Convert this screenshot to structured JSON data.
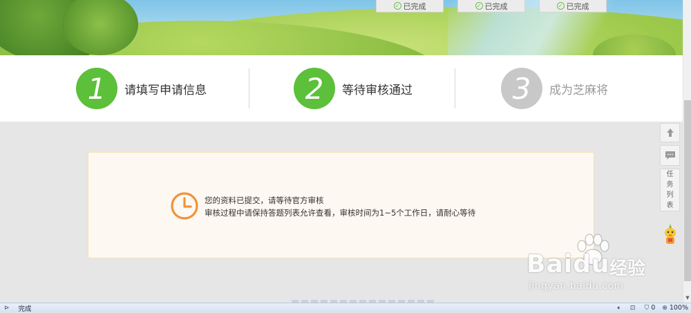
{
  "banner": {
    "done_tabs": [
      {
        "label": "已完成"
      },
      {
        "label": "已完成"
      },
      {
        "label": "已完成"
      }
    ]
  },
  "steps": [
    {
      "number": "1",
      "label": "请填写申请信息",
      "active": true
    },
    {
      "number": "2",
      "label": "等待审核通过",
      "active": true
    },
    {
      "number": "3",
      "label": "成为芝麻将",
      "active": false
    }
  ],
  "notice": {
    "line1": "您的资料已提交，请等待官方审核",
    "line2": "审核过程中请保持答题列表允许查看，审核时间为1~5个工作日，请耐心等待"
  },
  "sidebar_tools": {
    "back_to_top": "up-arrow-icon",
    "feedback": "chat-bubble-icon",
    "task_list_label": [
      "任",
      "务",
      "列",
      "表"
    ]
  },
  "watermark": {
    "brand": "Baidu",
    "brand_cn": "经验",
    "url": "jingyan.baidu.com"
  },
  "statusbar": {
    "status": "完成",
    "protected_count": "0",
    "zoom": "100%"
  },
  "colors": {
    "step_active": "#5cc03a",
    "step_inactive": "#c8c8c8",
    "clock": "#f0923a",
    "notice_bg": "#fdf8f1",
    "notice_border": "#f5dfb6"
  }
}
